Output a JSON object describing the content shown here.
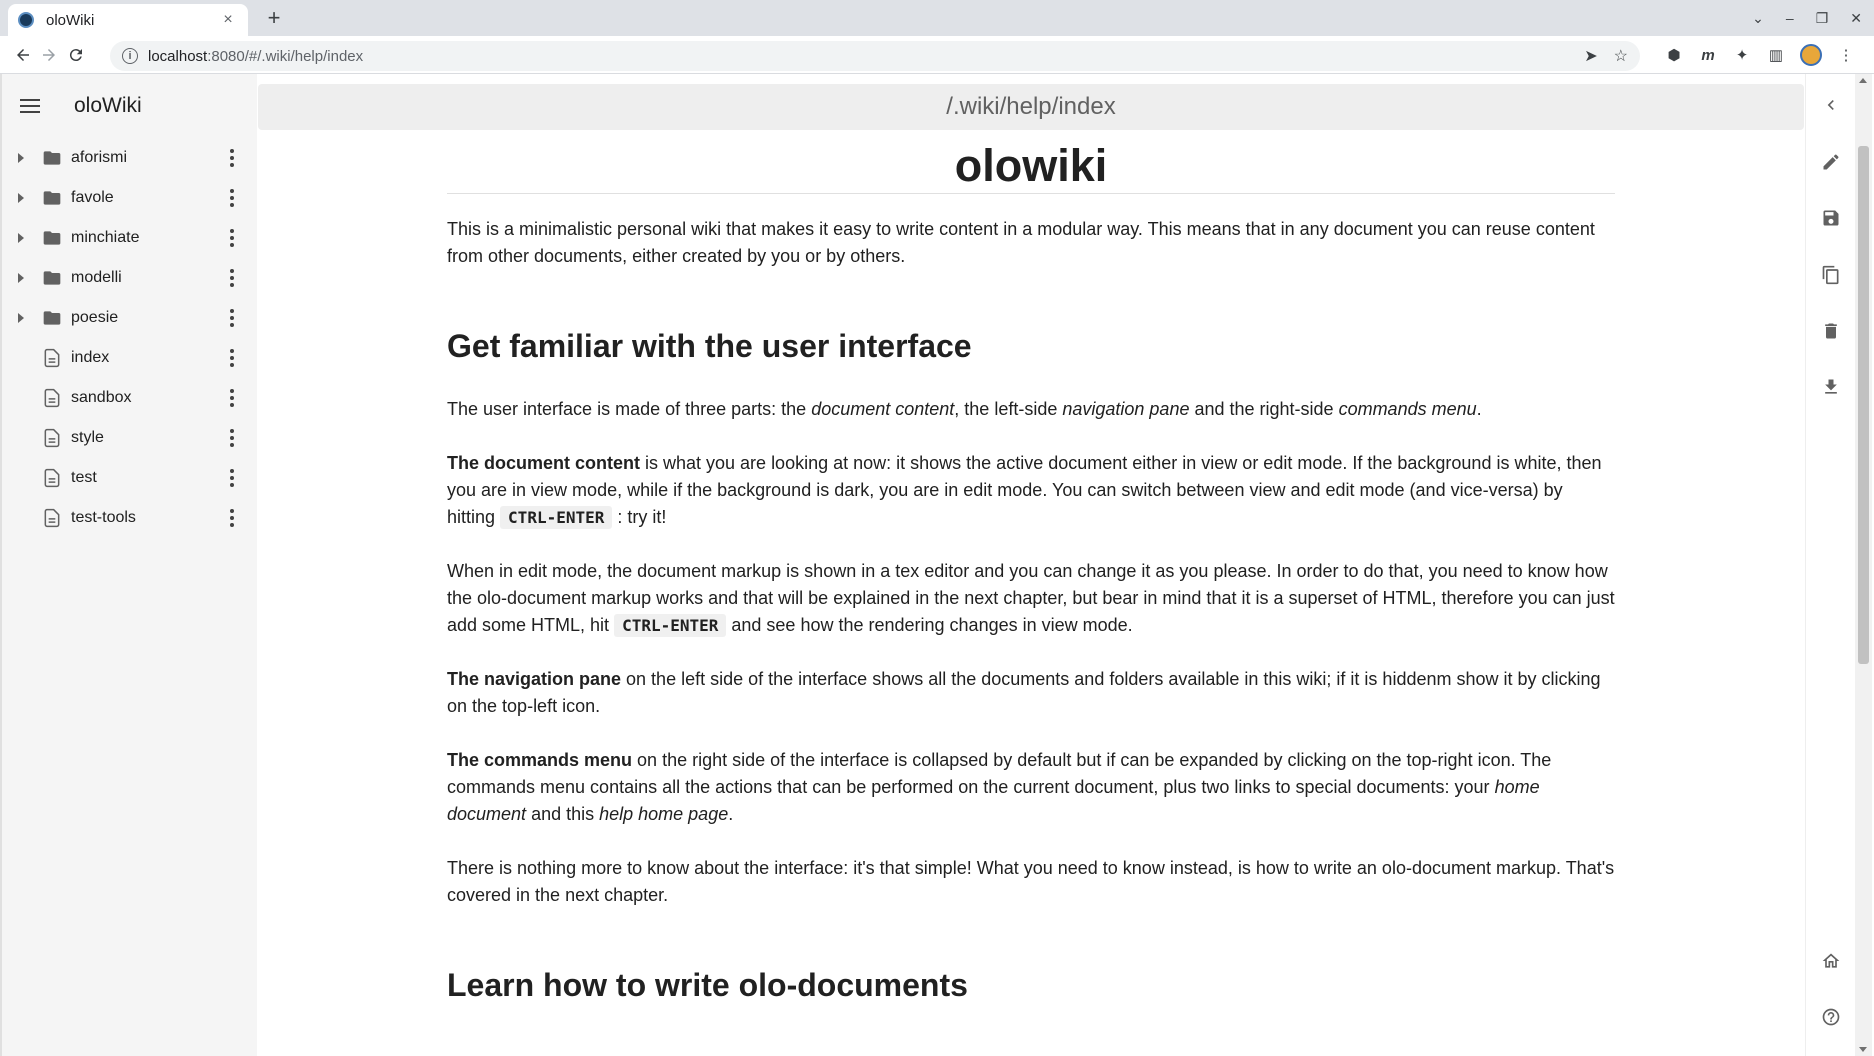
{
  "browser": {
    "tab_title": "oloWiki",
    "tab_close": "×",
    "new_tab": "+",
    "url_host": "localhost",
    "url_rest": ":8080/#/.wiki/help/index"
  },
  "sidebar": {
    "title": "oloWiki",
    "items": [
      {
        "label": "aforismi",
        "type": "folder"
      },
      {
        "label": "favole",
        "type": "folder"
      },
      {
        "label": "minchiate",
        "type": "folder"
      },
      {
        "label": "modelli",
        "type": "folder"
      },
      {
        "label": "poesie",
        "type": "folder"
      },
      {
        "label": "index",
        "type": "document"
      },
      {
        "label": "sandbox",
        "type": "document"
      },
      {
        "label": "style",
        "type": "document"
      },
      {
        "label": "test",
        "type": "document"
      },
      {
        "label": "test-tools",
        "type": "document"
      }
    ]
  },
  "topbar": {
    "path": "/.wiki/help/index"
  },
  "document": {
    "title": "olowiki",
    "intro": "This is a minimalistic personal wiki that makes it easy to write content in a modular way. This means that in any document you can reuse content from other documents, either created by you or by others.",
    "section1_heading": "Get familiar with the user interface",
    "p1_a": "The user interface is made of three parts: the ",
    "p1_i1": "document content",
    "p1_b": ", the left-side ",
    "p1_i2": "navigation pane",
    "p1_c": " and the right-side ",
    "p1_i3": "commands menu",
    "p1_d": ".",
    "p2_bold": "The document content",
    "p2_a": " is what you are looking at now: it shows the active document either in view or edit mode. If the background is white, then you are in view mode, while if the background is dark, you are in edit mode. You can switch between view and edit mode (and vice-versa) by hitting ",
    "p2_kbd": "CTRL-ENTER",
    "p2_b": " : try it!",
    "p3_a": "When in edit mode, the document markup is shown in a tex editor and you can change it as you please. In order to do that, you need to know how the olo-document markup works and that will be explained in the next chapter, but bear in mind that it is a superset of HTML, therefore you can just add some HTML, hit ",
    "p3_kbd": "CTRL-ENTER",
    "p3_b": " and see how the rendering changes in view mode.",
    "p4_bold": "The navigation pane",
    "p4_a": " on the left side of the interface shows all the documents and folders available in this wiki; if it is hiddenm show it by clicking on the top-left icon.",
    "p5_bold": "The commands menu",
    "p5_a": " on the right side of the interface is collapsed by default but if can be expanded by clicking on the top-right icon. The commands menu contains all the actions that can be performed on the current document, plus two links to special documents: your ",
    "p5_i1": "home document",
    "p5_b": " and this ",
    "p5_i2": "help home page",
    "p5_c": ".",
    "p6": "There is nothing more to know about the interface: it's that simple! What you need to know instead, is how to write an olo-document markup. That's covered in the next chapter.",
    "section2_heading": "Learn how to write olo-documents"
  },
  "colors": {
    "sidebar_bg": "#f5f5f5",
    "topbar_bg": "#eeeeee",
    "icon": "#616161",
    "text": "#212121"
  },
  "icons": {
    "commands": [
      "pencil-icon",
      "save-icon",
      "copy-icon",
      "delete-icon",
      "download-icon",
      "home-icon",
      "help-icon"
    ]
  }
}
